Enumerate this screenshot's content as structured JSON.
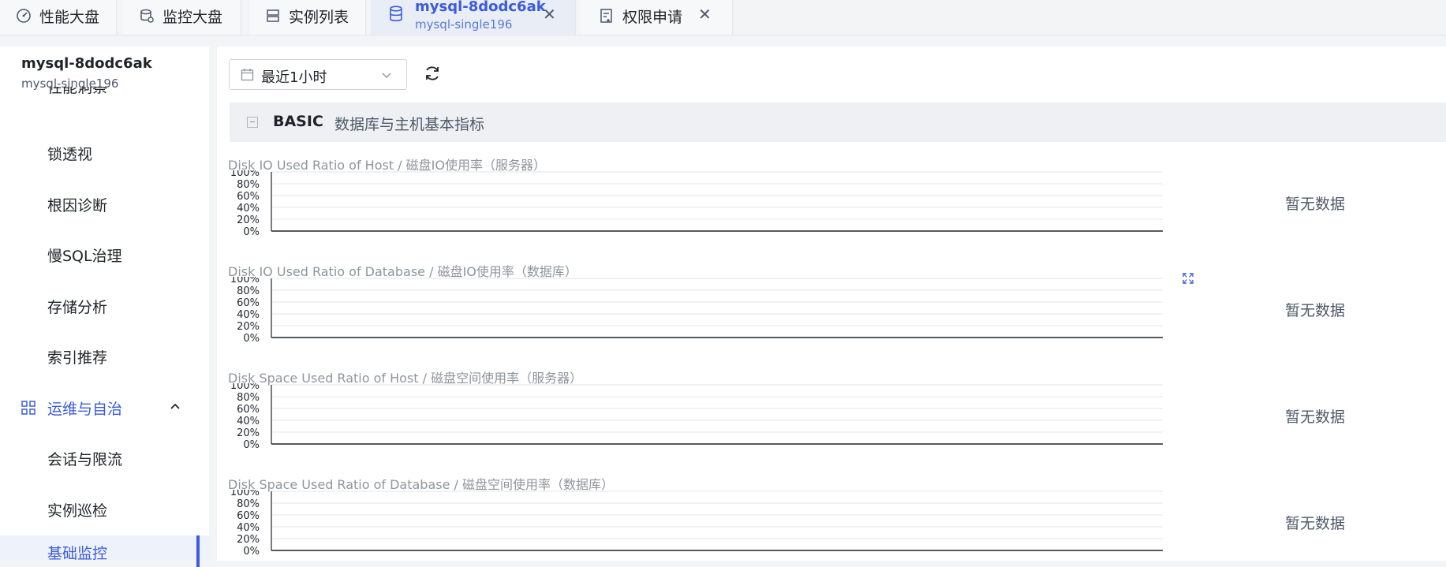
{
  "tabs": [
    {
      "label": "性能大盘",
      "icon": "dashboard-icon"
    },
    {
      "label": "监控大盘",
      "icon": "monitor-db-icon"
    },
    {
      "label": "实例列表",
      "icon": "server-list-icon"
    },
    {
      "label": "mysql-8dodc6ak",
      "sub": "mysql-single196",
      "icon": "database-icon",
      "active": true,
      "closable": true
    },
    {
      "label": "权限申请",
      "icon": "permission-form-icon",
      "closable": true
    }
  ],
  "sidebar": {
    "instance_name": "mysql-8dodc6ak",
    "instance_sub": "mysql-single196",
    "partial_item": "性能洞察",
    "items": [
      "锁透视",
      "根因诊断",
      "慢SQL治理",
      "存储分析",
      "索引推荐"
    ],
    "group": {
      "label": "运维与自治",
      "icon": "grid-icon",
      "expanded": true
    },
    "group_items": [
      "会话与限流",
      "实例巡检",
      "基础监控"
    ],
    "selected": "基础监控"
  },
  "toolbar": {
    "time_range": "最近1小时"
  },
  "section": {
    "title": "BASIC",
    "desc": "数据库与主机基本指标"
  },
  "chart_data": [
    {
      "type": "line",
      "title": "Disk IO Used Ratio of Host / 磁盘IO使用率（服务器）",
      "yticks": [
        "100%",
        "80%",
        "60%",
        "40%",
        "20%",
        "0%"
      ],
      "ylim": [
        0,
        100
      ],
      "series": [],
      "empty_text": "暂无数据"
    },
    {
      "type": "line",
      "title": "Disk IO Used Ratio of Database / 磁盘IO使用率（数据库）",
      "yticks": [
        "100%",
        "80%",
        "60%",
        "40%",
        "20%",
        "0%"
      ],
      "ylim": [
        0,
        100
      ],
      "series": [],
      "empty_text": "暂无数据"
    },
    {
      "type": "line",
      "title": "Disk Space Used Ratio of Host / 磁盘空间使用率（服务器）",
      "yticks": [
        "100%",
        "80%",
        "60%",
        "40%",
        "20%",
        "0%"
      ],
      "ylim": [
        0,
        100
      ],
      "series": [],
      "empty_text": "暂无数据"
    },
    {
      "type": "line",
      "title": "Disk Space Used Ratio of Database / 磁盘空间使用率（数据库）",
      "yticks": [
        "100%",
        "80%",
        "60%",
        "40%",
        "20%",
        "0%"
      ],
      "ylim": [
        0,
        100
      ],
      "series": [],
      "empty_text": "暂无数据"
    }
  ],
  "colors": {
    "accent": "#3b5bdb",
    "grid": "#e3e6ea",
    "axis": "#1f2329"
  }
}
